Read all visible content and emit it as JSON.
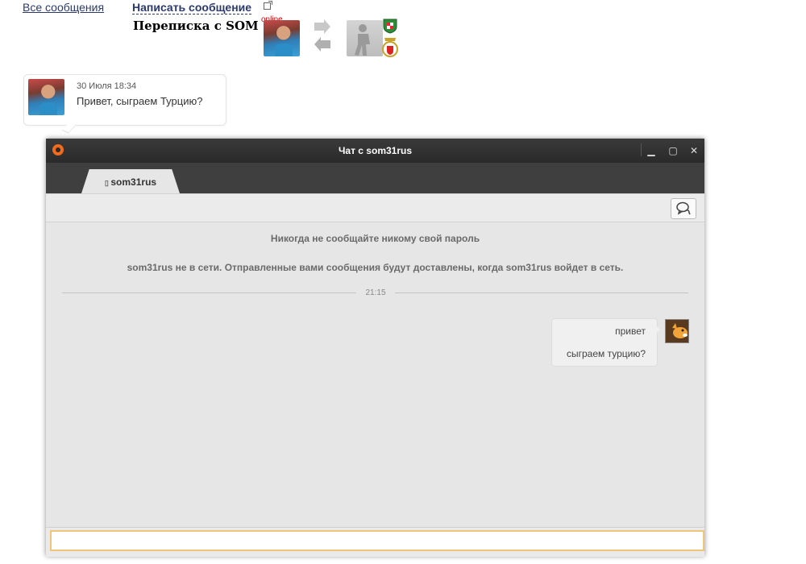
{
  "page": {
    "all_messages_link": "Все сообщения",
    "write_message_link": "Написать сообщение",
    "conversation_title": "Переписка с SOM",
    "status": "online"
  },
  "history": {
    "date": "30 Июля 18:34",
    "text": "Привет, сыграем Турцию?"
  },
  "chat_window": {
    "title": "Чат с som31rus",
    "tab_label": "som31rus",
    "system_messages": [
      "Никогда не сообщайте никому свой пароль",
      "som31rus не в сети. Отправленные вами сообщения будут доставлены, когда som31rus войдет в сеть."
    ],
    "time_divider": "21:15",
    "outgoing_message": {
      "lines": [
        "привет",
        "сыграем турцию?"
      ]
    },
    "input": {
      "value": "",
      "placeholder": ""
    },
    "colors": {
      "titlebar": "#2a2a2a",
      "accent": "#f26b1d",
      "input_border": "#f0c57a"
    }
  },
  "icons": {
    "window_controls": [
      "minimize-icon",
      "maximize-icon",
      "close-icon"
    ],
    "origin_logo": "origin-logo-icon",
    "swap": "swap-arrows-icon",
    "chat": "chat-bubbles-icon"
  }
}
